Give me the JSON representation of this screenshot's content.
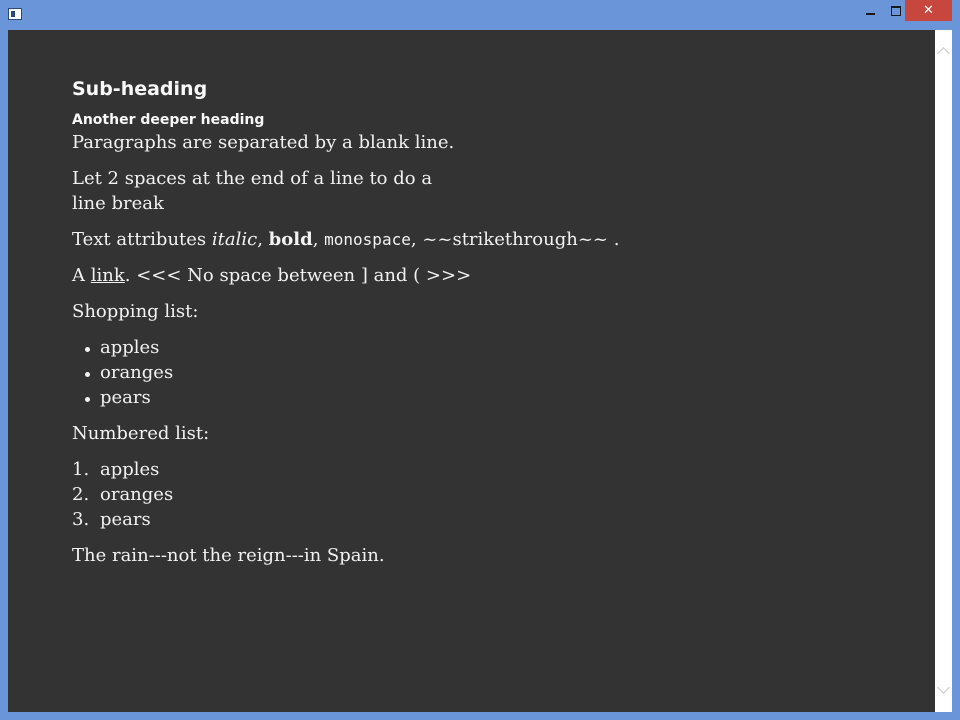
{
  "window": {
    "controls": {
      "minimize": "minimize",
      "maximize": "maximize",
      "close": "✕"
    }
  },
  "document": {
    "subheading": "Sub-heading",
    "deeper_heading": "Another deeper heading",
    "para1": "Paragraphs are separated by a blank line.",
    "para2_line1": "Let 2 spaces at the end of a line to do a",
    "para2_line2": "line break",
    "attrs": {
      "prefix": "Text attributes ",
      "italic": "italic",
      "sep1": ", ",
      "bold": "bold",
      "sep2": ", ",
      "mono": "monospace",
      "suffix": ", ~~strikethrough~~ ."
    },
    "link_line": {
      "prefix": "A ",
      "link": "link",
      "suffix": ". <<< No space between ] and ( >>>"
    },
    "shopping_label": "Shopping list:",
    "shopping_items": [
      "apples",
      "oranges",
      "pears"
    ],
    "numbered_label": "Numbered list:",
    "numbered_items": [
      {
        "num": "1.",
        "text": "apples"
      },
      {
        "num": "2.",
        "text": "oranges"
      },
      {
        "num": "3.",
        "text": "pears"
      }
    ],
    "final_line": "The rain---not the reign---in Spain."
  }
}
